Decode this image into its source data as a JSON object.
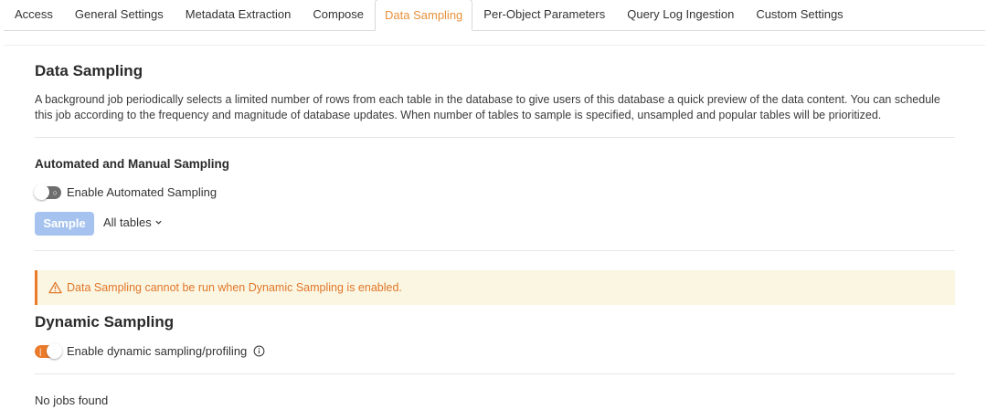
{
  "tabs": [
    {
      "label": "Access",
      "active": false
    },
    {
      "label": "General Settings",
      "active": false
    },
    {
      "label": "Metadata Extraction",
      "active": false
    },
    {
      "label": "Compose",
      "active": false
    },
    {
      "label": "Data Sampling",
      "active": true
    },
    {
      "label": "Per-Object Parameters",
      "active": false
    },
    {
      "label": "Query Log Ingestion",
      "active": false
    },
    {
      "label": "Custom Settings",
      "active": false
    }
  ],
  "data_sampling": {
    "title": "Data Sampling",
    "description": "A background job periodically selects a limited number of rows from each table in the database to give users of this database a quick preview of the data content. You can schedule this job according to the frequency and magnitude of database updates. When number of tables to sample is specified, unsampled and popular tables will be prioritized."
  },
  "automated": {
    "title": "Automated and Manual Sampling",
    "toggle_label": "Enable Automated Sampling",
    "toggle_on": false,
    "sample_button": "Sample",
    "scope_dropdown": "All tables"
  },
  "alert": {
    "message": "Data Sampling cannot be run when Dynamic Sampling is enabled.",
    "icon": "warning-triangle-icon"
  },
  "dynamic": {
    "title": "Dynamic Sampling",
    "toggle_label": "Enable dynamic sampling/profiling",
    "toggle_on": true,
    "info_icon": "info-circle-icon"
  },
  "jobs": {
    "empty_text": "No jobs found"
  },
  "colors": {
    "accent_orange": "#ea7b2b",
    "button_disabled_blue": "#a6c3ef",
    "alert_bg": "#fbf6e2"
  }
}
